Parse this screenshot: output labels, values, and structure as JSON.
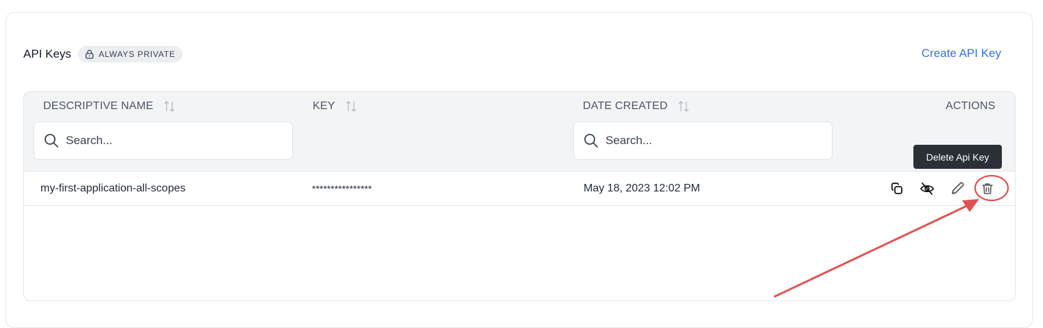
{
  "section": {
    "title": "API Keys",
    "badge": "ALWAYS PRIVATE",
    "create_link": "Create API Key"
  },
  "table": {
    "columns": {
      "name": "DESCRIPTIVE NAME",
      "key": "KEY",
      "date": "DATE CREATED",
      "actions": "ACTIONS"
    },
    "search_name_placeholder": "Search...",
    "search_date_placeholder": "Search...",
    "rows": [
      {
        "name": "my-first-application-all-scopes",
        "key": "****************",
        "date_created": "May 18, 2023 12:02 PM"
      }
    ]
  },
  "actions": {
    "icons": [
      "copy-icon",
      "eye-off-icon",
      "pencil-icon",
      "trash-icon"
    ]
  },
  "tooltip": {
    "text": "Delete Api Key"
  },
  "colors": {
    "link": "#3b6fd8",
    "header_bg": "#f3f4f6",
    "tooltip_bg": "#2b2f36",
    "annotation": "#e05252"
  }
}
